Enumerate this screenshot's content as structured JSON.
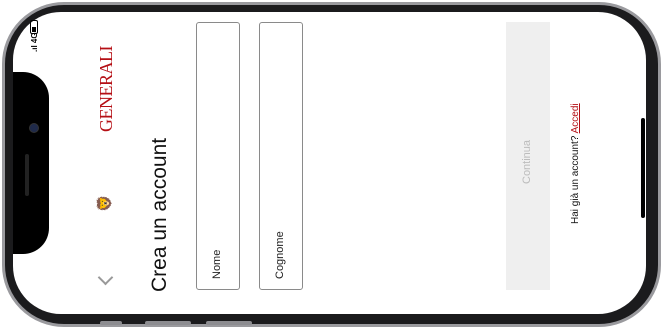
{
  "status": {
    "network": ".ıl 4G"
  },
  "brand": {
    "logo_text": "GENERALI",
    "lion_glyph": "🦁"
  },
  "header": {
    "title": "Crea un account"
  },
  "form": {
    "first_name_placeholder": "Nome",
    "last_name_placeholder": "Cognome"
  },
  "actions": {
    "continue_label": "Continua"
  },
  "footer": {
    "prompt": "Hai già un account?",
    "login_link": "Accedi"
  },
  "colors": {
    "brand_red": "#b50f15",
    "button_disabled_bg": "#efefef"
  }
}
